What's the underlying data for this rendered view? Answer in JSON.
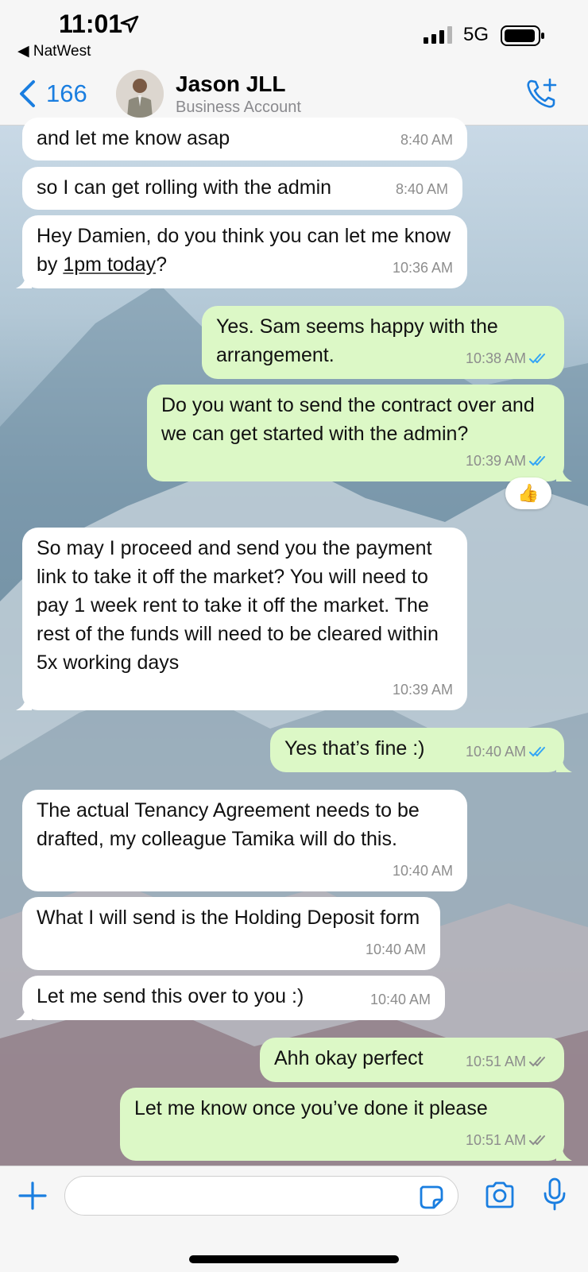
{
  "status_bar": {
    "time": "11:01",
    "back_app": "NatWest",
    "network": "5G"
  },
  "header": {
    "back_count": "166",
    "contact_name": "Jason JLL",
    "contact_subtitle": "Business Account"
  },
  "messages": [
    {
      "side": "in",
      "text": "and let me know asap",
      "time": "8:40 AM"
    },
    {
      "side": "in",
      "text": "so I can get rolling with the admin",
      "time": "8:40 AM"
    },
    {
      "side": "in",
      "text_before": "Hey Damien, do you think you can let me know by ",
      "text_link": "1pm today",
      "text_after": "?",
      "time": "10:36 AM"
    },
    {
      "side": "out",
      "text": "Yes. Sam seems happy with the arrangement.",
      "time": "10:38 AM",
      "status": "read"
    },
    {
      "side": "out",
      "text": "Do you want to send the contract over and we can get started with the admin?",
      "time": "10:39 AM",
      "status": "read",
      "reaction": "👍"
    },
    {
      "side": "in",
      "text": "So may I proceed and send you the payment link to take it off the market? You will need to pay 1 week rent to take it off the market. The rest of the funds will need to be cleared within 5x working days",
      "time": "10:39 AM"
    },
    {
      "side": "out",
      "text": "Yes that’s fine :)",
      "time": "10:40 AM",
      "status": "read"
    },
    {
      "side": "in",
      "text": "The actual Tenancy Agreement needs to be drafted, my colleague Tamika will do this.",
      "time": "10:40 AM"
    },
    {
      "side": "in",
      "text": "What I will send is the Holding Deposit form",
      "time": "10:40 AM"
    },
    {
      "side": "in",
      "text": "Let me send this over to you :)",
      "time": "10:40 AM"
    },
    {
      "side": "out",
      "text": "Ahh okay perfect",
      "time": "10:51 AM",
      "status": "delivered"
    },
    {
      "side": "out",
      "text": "Let me know once you’ve done it please",
      "time": "10:51 AM",
      "status": "delivered"
    }
  ],
  "composer": {
    "placeholder": ""
  },
  "colors": {
    "accent": "#1a7ee0",
    "outgoing_bubble": "#dcf8c6",
    "incoming_bubble": "#ffffff",
    "read_tick": "#34a5f5",
    "delivered_tick": "#8d8d8d"
  },
  "icons": [
    "location-arrow-icon",
    "signal-icon",
    "battery-icon",
    "chevron-left-icon",
    "call-add-icon",
    "plus-icon",
    "sticker-icon",
    "camera-icon",
    "mic-icon",
    "double-check-icon"
  ]
}
